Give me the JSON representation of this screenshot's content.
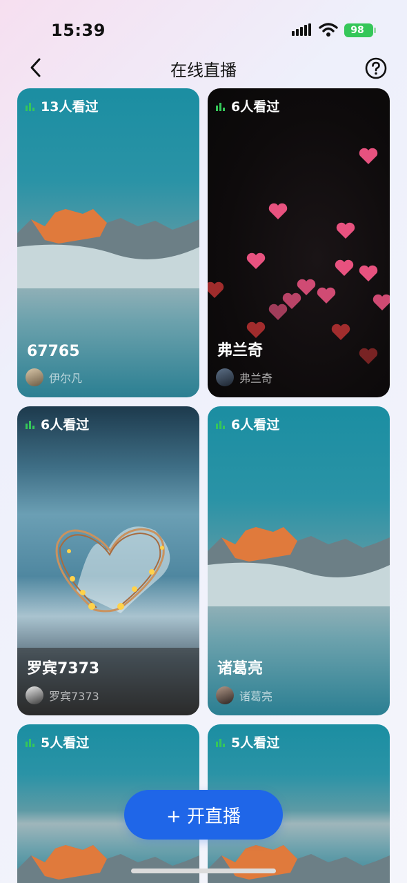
{
  "status_bar": {
    "time": "15:39",
    "battery": "98"
  },
  "nav": {
    "title": "在线直播"
  },
  "rooms": [
    {
      "viewers": "13人看过",
      "title": "67765",
      "host": "伊尔凡",
      "cover": "mountain"
    },
    {
      "viewers": "6人看过",
      "title": "弗兰奇",
      "host": "弗兰奇",
      "cover": "hearts"
    },
    {
      "viewers": "6人看过",
      "title": "罗宾7373",
      "host": "罗宾7373",
      "cover": "wire-heart"
    },
    {
      "viewers": "6人看过",
      "title": "诸葛亮",
      "host": "诸葛亮",
      "cover": "mountain"
    },
    {
      "viewers": "5人看过",
      "title": "",
      "host": "",
      "cover": "mountain"
    },
    {
      "viewers": "5人看过",
      "title": "",
      "host": "",
      "cover": "mountain"
    }
  ],
  "actions": {
    "start_live": "+ 开直播"
  },
  "colors": {
    "primary": "#1f66e8",
    "viewer_icon": "#35c759"
  }
}
